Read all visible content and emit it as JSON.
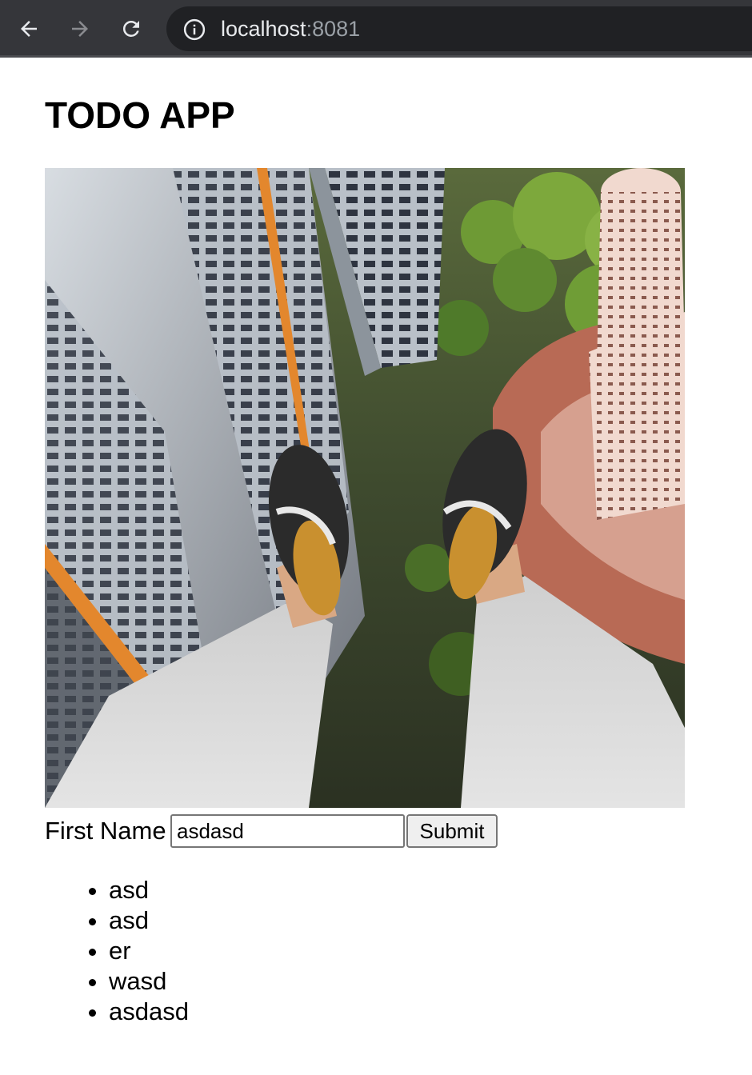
{
  "browser": {
    "url_host": "localhost",
    "url_port": ":8081",
    "icons": {
      "back": "arrow-left-icon",
      "forward": "arrow-right-icon",
      "reload": "reload-icon",
      "info": "info-icon"
    }
  },
  "page": {
    "title": "TODO APP",
    "image_icon": "photo-image"
  },
  "form": {
    "label": "First Name",
    "input_value": "asdasd",
    "submit_label": "Submit"
  },
  "todos": [
    {
      "text": "asd"
    },
    {
      "text": "asd"
    },
    {
      "text": "er"
    },
    {
      "text": "wasd"
    },
    {
      "text": "asdasd"
    }
  ],
  "colors": {
    "toolbar_bg": "#35363a",
    "omnibox_bg": "#202124",
    "url_text": "#e8eaed",
    "url_port": "#9aa0a6"
  }
}
